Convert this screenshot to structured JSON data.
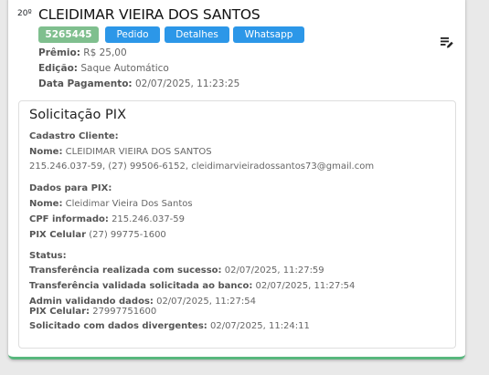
{
  "header": {
    "rank": "20º",
    "name": "CLEIDIMAR VIEIRA DOS SANTOS",
    "buttons": {
      "code": "5265445",
      "pedido": "Pedido",
      "detalhes": "Detalhes",
      "whatsapp": "Whatsapp"
    },
    "premio_label": "Prêmio:",
    "premio_value": "R$ 25,00",
    "edicao_label": "Edição:",
    "edicao_value": "Saque Automático",
    "pagamento_label": "Data Pagamento:",
    "pagamento_value": "02/07/2025, 11:23:25",
    "edit_icon": "edit-list-icon"
  },
  "pix": {
    "title": "Solicitação PIX",
    "cadastro_heading": "Cadastro Cliente:",
    "cadastro_nome_label": "Nome:",
    "cadastro_nome_value": "CLEIDIMAR VIEIRA DOS SANTOS",
    "cadastro_contact": "215.246.037-59, (27) 99506-6152, cleidimarvieiradossantos73@gmail.com",
    "dados_heading": "Dados para PIX:",
    "dados_nome_label": "Nome:",
    "dados_nome_value": "Cleidimar Vieira Dos Santos",
    "cpf_label": "CPF informado:",
    "cpf_value": "215.246.037-59",
    "celular_label": "PIX Celular",
    "celular_value": "(27) 99775-1600",
    "status_heading": "Status:",
    "status": [
      {
        "label": "Transferência realizada com sucesso:",
        "value": "02/07/2025, 11:27:59"
      },
      {
        "label": "Transferência validada solicitada ao banco:",
        "value": "02/07/2025, 11:27:54"
      },
      {
        "label": "Admin validando dados:",
        "value": "02/07/2025, 11:27:54"
      },
      {
        "label": "PIX Celular:",
        "value": "27997751600"
      },
      {
        "label": "Solicitado com dados divergentes:",
        "value": "02/07/2025, 11:24:11"
      }
    ]
  }
}
